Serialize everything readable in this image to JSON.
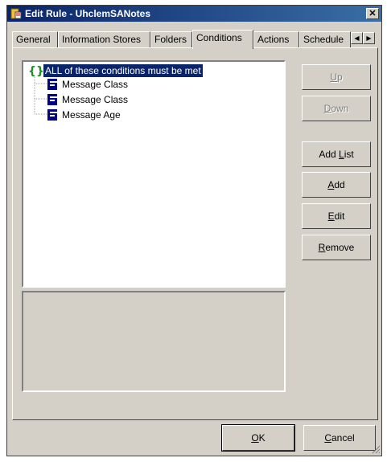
{
  "window": {
    "title": "Edit Rule - UhclemSANotes"
  },
  "tabs": [
    {
      "label": "General",
      "active": false
    },
    {
      "label": "Information Stores",
      "active": false
    },
    {
      "label": "Folders",
      "active": false
    },
    {
      "label": "Conditions",
      "active": true
    },
    {
      "label": "Actions",
      "active": false
    },
    {
      "label": "Schedule",
      "active": false
    }
  ],
  "tree": {
    "root": "ALL of these conditions must be met",
    "items": [
      "Message Class",
      "Message Class",
      "Message Age"
    ]
  },
  "buttons": {
    "up": {
      "pre": "",
      "key": "U",
      "post": "p"
    },
    "down": {
      "pre": "",
      "key": "D",
      "post": "own"
    },
    "add_list": {
      "pre": "Add ",
      "key": "L",
      "post": "ist"
    },
    "add": {
      "pre": "",
      "key": "A",
      "post": "dd"
    },
    "edit": {
      "pre": "",
      "key": "E",
      "post": "dit"
    },
    "remove": {
      "pre": "",
      "key": "R",
      "post": "emove"
    }
  },
  "footer": {
    "ok": {
      "pre": "",
      "key": "O",
      "post": "K"
    },
    "cancel": {
      "pre": "",
      "key": "C",
      "post": "ancel"
    }
  },
  "colors": {
    "titlebar": "#0a246a",
    "selection": "#0a246a",
    "face": "#d4d0c8",
    "leaf_icon": "#00008b",
    "root_icon": "#228b22"
  }
}
